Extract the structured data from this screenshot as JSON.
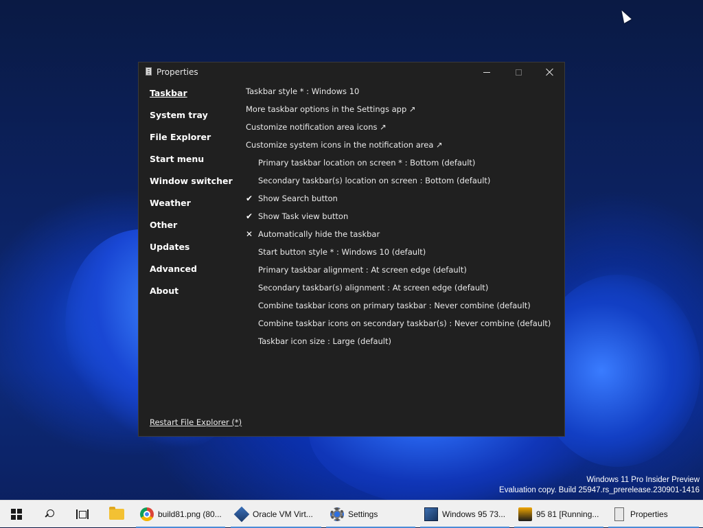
{
  "window": {
    "title": "Properties",
    "controls": {
      "minimize": "minimize-icon",
      "maximize": "maximize-icon",
      "close": "close-icon"
    }
  },
  "nav": {
    "items": [
      {
        "label": "Taskbar",
        "active": true
      },
      {
        "label": "System tray"
      },
      {
        "label": "File Explorer"
      },
      {
        "label": "Start menu"
      },
      {
        "label": "Window switcher"
      },
      {
        "label": "Weather"
      },
      {
        "label": "Other"
      },
      {
        "label": "Updates"
      },
      {
        "label": "Advanced"
      },
      {
        "label": "About"
      }
    ]
  },
  "options": [
    {
      "label": "Taskbar style * : Windows 10",
      "mark": ""
    },
    {
      "label": "More taskbar options in the Settings app ↗",
      "mark": ""
    },
    {
      "label": "Customize notification area icons ↗",
      "mark": ""
    },
    {
      "label": "Customize system icons in the notification area ↗",
      "mark": ""
    },
    {
      "label": "Primary taskbar location on screen * : Bottom (default)",
      "mark": ""
    },
    {
      "label": "Secondary taskbar(s) location on screen : Bottom (default)",
      "mark": ""
    },
    {
      "label": "Show Search button",
      "mark": "✔"
    },
    {
      "label": "Show Task view button",
      "mark": "✔"
    },
    {
      "label": "Automatically hide the taskbar",
      "mark": "✕"
    },
    {
      "label": "Start button style * : Windows 10 (default)",
      "mark": ""
    },
    {
      "label": "Primary taskbar alignment : At screen edge (default)",
      "mark": ""
    },
    {
      "label": "Secondary taskbar(s) alignment : At screen edge (default)",
      "mark": ""
    },
    {
      "label": "Combine taskbar icons on primary taskbar : Never combine (default)",
      "mark": ""
    },
    {
      "label": "Combine taskbar icons on secondary taskbar(s) : Never combine (default)",
      "mark": ""
    },
    {
      "label": "Taskbar icon size : Large (default)",
      "mark": ""
    }
  ],
  "restart_link": "Restart File Explorer (*)",
  "watermark": {
    "line1": "Windows 11 Pro Insider Preview",
    "line2": "Evaluation copy. Build 25947.rs_prerelease.230901-1416"
  },
  "taskbar": {
    "start_icon": "windows-logo-icon",
    "search_icon": "search-icon",
    "taskview_icon": "task-view-icon",
    "pinned_icon": "file-explorer-icon",
    "tasks": [
      {
        "label": "build81.png (80...",
        "icon": "chrome-icon"
      },
      {
        "label": "Oracle VM Virt...",
        "icon": "virtualbox-icon"
      },
      {
        "label": "Settings",
        "icon": "settings-gear-icon"
      },
      {
        "label": "Windows 95 73...",
        "icon": "windows95-icon"
      },
      {
        "label": "95 81 [Running...",
        "icon": "vm-running-icon"
      },
      {
        "label": "Properties",
        "icon": "properties-icon"
      }
    ]
  }
}
